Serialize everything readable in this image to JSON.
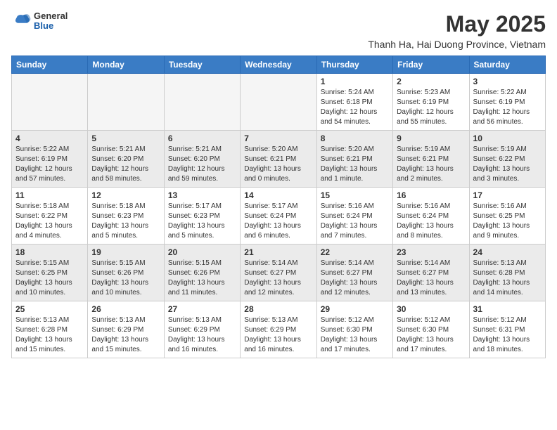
{
  "header": {
    "logo": {
      "general": "General",
      "blue": "Blue"
    },
    "title": "May 2025",
    "location": "Thanh Ha, Hai Duong Province, Vietnam"
  },
  "days_of_week": [
    "Sunday",
    "Monday",
    "Tuesday",
    "Wednesday",
    "Thursday",
    "Friday",
    "Saturday"
  ],
  "weeks": [
    {
      "shaded": false,
      "days": [
        {
          "num": "",
          "empty": true,
          "lines": []
        },
        {
          "num": "",
          "empty": true,
          "lines": []
        },
        {
          "num": "",
          "empty": true,
          "lines": []
        },
        {
          "num": "",
          "empty": true,
          "lines": []
        },
        {
          "num": "1",
          "empty": false,
          "lines": [
            "Sunrise: 5:24 AM",
            "Sunset: 6:18 PM",
            "Daylight: 12 hours",
            "and 54 minutes."
          ]
        },
        {
          "num": "2",
          "empty": false,
          "lines": [
            "Sunrise: 5:23 AM",
            "Sunset: 6:19 PM",
            "Daylight: 12 hours",
            "and 55 minutes."
          ]
        },
        {
          "num": "3",
          "empty": false,
          "lines": [
            "Sunrise: 5:22 AM",
            "Sunset: 6:19 PM",
            "Daylight: 12 hours",
            "and 56 minutes."
          ]
        }
      ]
    },
    {
      "shaded": true,
      "days": [
        {
          "num": "4",
          "empty": false,
          "lines": [
            "Sunrise: 5:22 AM",
            "Sunset: 6:19 PM",
            "Daylight: 12 hours",
            "and 57 minutes."
          ]
        },
        {
          "num": "5",
          "empty": false,
          "lines": [
            "Sunrise: 5:21 AM",
            "Sunset: 6:20 PM",
            "Daylight: 12 hours",
            "and 58 minutes."
          ]
        },
        {
          "num": "6",
          "empty": false,
          "lines": [
            "Sunrise: 5:21 AM",
            "Sunset: 6:20 PM",
            "Daylight: 12 hours",
            "and 59 minutes."
          ]
        },
        {
          "num": "7",
          "empty": false,
          "lines": [
            "Sunrise: 5:20 AM",
            "Sunset: 6:21 PM",
            "Daylight: 13 hours",
            "and 0 minutes."
          ]
        },
        {
          "num": "8",
          "empty": false,
          "lines": [
            "Sunrise: 5:20 AM",
            "Sunset: 6:21 PM",
            "Daylight: 13 hours",
            "and 1 minute."
          ]
        },
        {
          "num": "9",
          "empty": false,
          "lines": [
            "Sunrise: 5:19 AM",
            "Sunset: 6:21 PM",
            "Daylight: 13 hours",
            "and 2 minutes."
          ]
        },
        {
          "num": "10",
          "empty": false,
          "lines": [
            "Sunrise: 5:19 AM",
            "Sunset: 6:22 PM",
            "Daylight: 13 hours",
            "and 3 minutes."
          ]
        }
      ]
    },
    {
      "shaded": false,
      "days": [
        {
          "num": "11",
          "empty": false,
          "lines": [
            "Sunrise: 5:18 AM",
            "Sunset: 6:22 PM",
            "Daylight: 13 hours",
            "and 4 minutes."
          ]
        },
        {
          "num": "12",
          "empty": false,
          "lines": [
            "Sunrise: 5:18 AM",
            "Sunset: 6:23 PM",
            "Daylight: 13 hours",
            "and 5 minutes."
          ]
        },
        {
          "num": "13",
          "empty": false,
          "lines": [
            "Sunrise: 5:17 AM",
            "Sunset: 6:23 PM",
            "Daylight: 13 hours",
            "and 5 minutes."
          ]
        },
        {
          "num": "14",
          "empty": false,
          "lines": [
            "Sunrise: 5:17 AM",
            "Sunset: 6:24 PM",
            "Daylight: 13 hours",
            "and 6 minutes."
          ]
        },
        {
          "num": "15",
          "empty": false,
          "lines": [
            "Sunrise: 5:16 AM",
            "Sunset: 6:24 PM",
            "Daylight: 13 hours",
            "and 7 minutes."
          ]
        },
        {
          "num": "16",
          "empty": false,
          "lines": [
            "Sunrise: 5:16 AM",
            "Sunset: 6:24 PM",
            "Daylight: 13 hours",
            "and 8 minutes."
          ]
        },
        {
          "num": "17",
          "empty": false,
          "lines": [
            "Sunrise: 5:16 AM",
            "Sunset: 6:25 PM",
            "Daylight: 13 hours",
            "and 9 minutes."
          ]
        }
      ]
    },
    {
      "shaded": true,
      "days": [
        {
          "num": "18",
          "empty": false,
          "lines": [
            "Sunrise: 5:15 AM",
            "Sunset: 6:25 PM",
            "Daylight: 13 hours",
            "and 10 minutes."
          ]
        },
        {
          "num": "19",
          "empty": false,
          "lines": [
            "Sunrise: 5:15 AM",
            "Sunset: 6:26 PM",
            "Daylight: 13 hours",
            "and 10 minutes."
          ]
        },
        {
          "num": "20",
          "empty": false,
          "lines": [
            "Sunrise: 5:15 AM",
            "Sunset: 6:26 PM",
            "Daylight: 13 hours",
            "and 11 minutes."
          ]
        },
        {
          "num": "21",
          "empty": false,
          "lines": [
            "Sunrise: 5:14 AM",
            "Sunset: 6:27 PM",
            "Daylight: 13 hours",
            "and 12 minutes."
          ]
        },
        {
          "num": "22",
          "empty": false,
          "lines": [
            "Sunrise: 5:14 AM",
            "Sunset: 6:27 PM",
            "Daylight: 13 hours",
            "and 12 minutes."
          ]
        },
        {
          "num": "23",
          "empty": false,
          "lines": [
            "Sunrise: 5:14 AM",
            "Sunset: 6:27 PM",
            "Daylight: 13 hours",
            "and 13 minutes."
          ]
        },
        {
          "num": "24",
          "empty": false,
          "lines": [
            "Sunrise: 5:13 AM",
            "Sunset: 6:28 PM",
            "Daylight: 13 hours",
            "and 14 minutes."
          ]
        }
      ]
    },
    {
      "shaded": false,
      "days": [
        {
          "num": "25",
          "empty": false,
          "lines": [
            "Sunrise: 5:13 AM",
            "Sunset: 6:28 PM",
            "Daylight: 13 hours",
            "and 15 minutes."
          ]
        },
        {
          "num": "26",
          "empty": false,
          "lines": [
            "Sunrise: 5:13 AM",
            "Sunset: 6:29 PM",
            "Daylight: 13 hours",
            "and 15 minutes."
          ]
        },
        {
          "num": "27",
          "empty": false,
          "lines": [
            "Sunrise: 5:13 AM",
            "Sunset: 6:29 PM",
            "Daylight: 13 hours",
            "and 16 minutes."
          ]
        },
        {
          "num": "28",
          "empty": false,
          "lines": [
            "Sunrise: 5:13 AM",
            "Sunset: 6:29 PM",
            "Daylight: 13 hours",
            "and 16 minutes."
          ]
        },
        {
          "num": "29",
          "empty": false,
          "lines": [
            "Sunrise: 5:12 AM",
            "Sunset: 6:30 PM",
            "Daylight: 13 hours",
            "and 17 minutes."
          ]
        },
        {
          "num": "30",
          "empty": false,
          "lines": [
            "Sunrise: 5:12 AM",
            "Sunset: 6:30 PM",
            "Daylight: 13 hours",
            "and 17 minutes."
          ]
        },
        {
          "num": "31",
          "empty": false,
          "lines": [
            "Sunrise: 5:12 AM",
            "Sunset: 6:31 PM",
            "Daylight: 13 hours",
            "and 18 minutes."
          ]
        }
      ]
    }
  ]
}
